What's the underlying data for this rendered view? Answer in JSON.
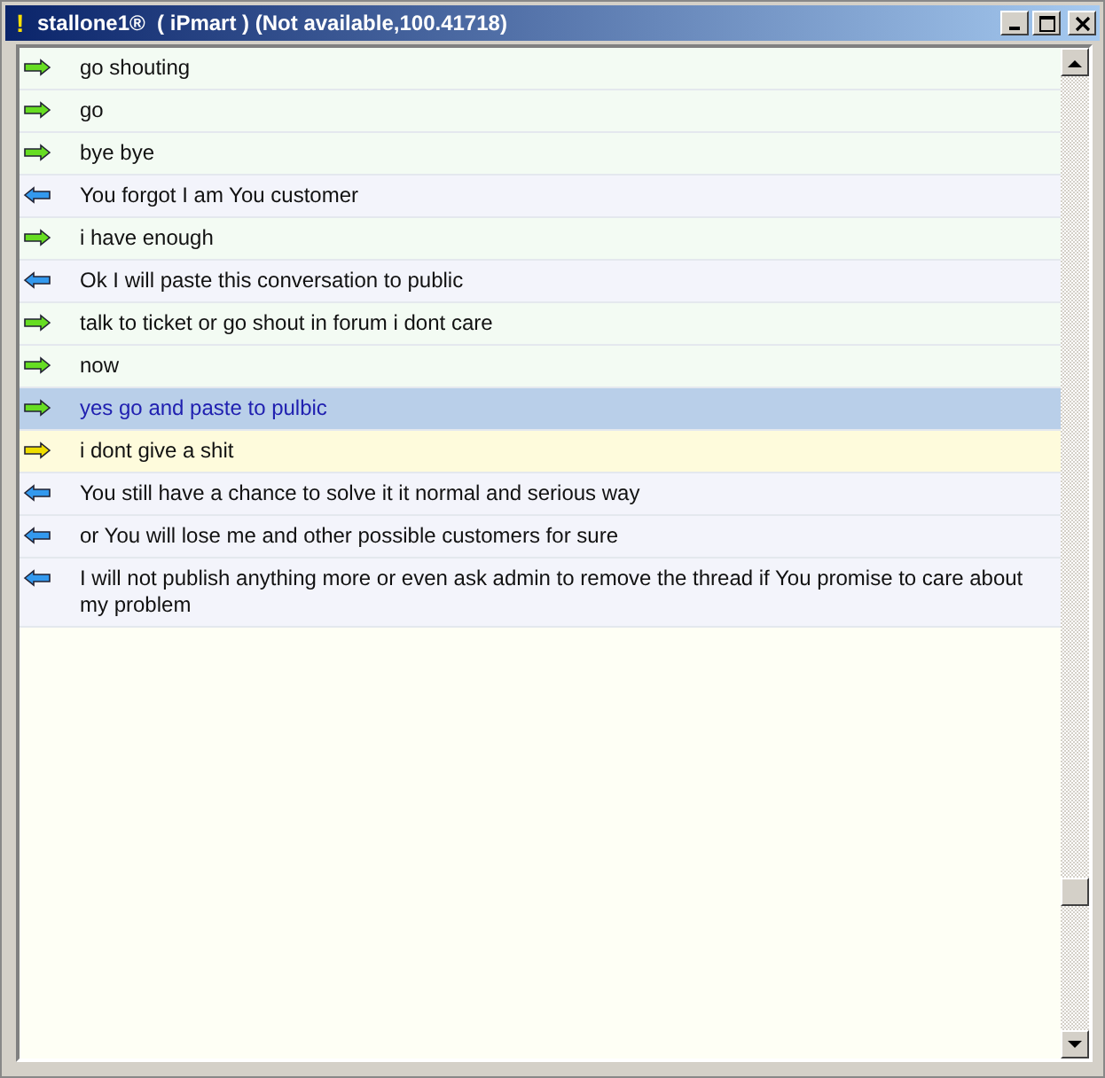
{
  "window": {
    "title": "stallone1®  ( iPmart ) (Not available,100.41718)",
    "alert_mark": "!"
  },
  "messages": [
    {
      "kind": "out",
      "text": "go shouting",
      "selected": false
    },
    {
      "kind": "out",
      "text": "go",
      "selected": false
    },
    {
      "kind": "out",
      "text": "bye bye",
      "selected": false
    },
    {
      "kind": "in",
      "text": "You forgot I am You customer",
      "selected": false
    },
    {
      "kind": "out",
      "text": "i have enough",
      "selected": false
    },
    {
      "kind": "in",
      "text": "Ok I will paste this conversation to public",
      "selected": false
    },
    {
      "kind": "out",
      "text": "talk to ticket or go shout in forum i dont care",
      "selected": false
    },
    {
      "kind": "out",
      "text": "now",
      "selected": false
    },
    {
      "kind": "out",
      "text": "yes go and paste to pulbic",
      "selected": true
    },
    {
      "kind": "flagged",
      "text": "i dont give a shit",
      "selected": false
    },
    {
      "kind": "in",
      "text": "You still have a chance to solve it it normal and serious way",
      "selected": false
    },
    {
      "kind": "in",
      "text": "or You will lose me and other possible customers for sure",
      "selected": false
    },
    {
      "kind": "in",
      "text": "I will not publish anything more or even ask admin to remove the thread if You promise to care about my problem",
      "selected": false
    }
  ]
}
